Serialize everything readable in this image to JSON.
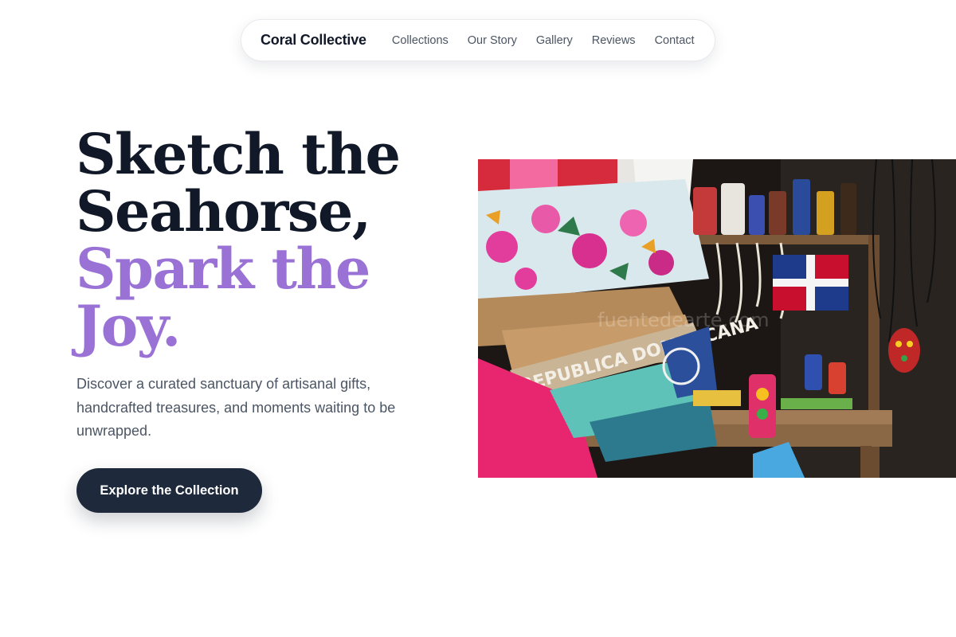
{
  "nav": {
    "brand": "Coral Collective",
    "links": [
      "Collections",
      "Our Story",
      "Gallery",
      "Reviews",
      "Contact"
    ]
  },
  "hero": {
    "headline": {
      "line1": "Sketch the",
      "line2": "Seahorse,",
      "line3": "Spark the",
      "line4": "Joy."
    },
    "subtitle": "Discover a curated sanctuary of artisanal gifts, handcrafted treasures, and moments waiting to be unwrapped.",
    "cta_label": "Explore the Collection",
    "image": {
      "banner_text": "REPUBLICA DOMINICANA",
      "watermark": "fuentedearte.com"
    }
  },
  "colors": {
    "text_dark": "#111827",
    "accent_purple": "#9a72d6",
    "button_bg": "#1e293b",
    "body_text": "#4b5563"
  }
}
